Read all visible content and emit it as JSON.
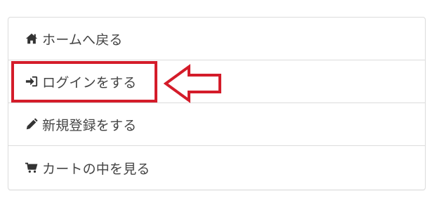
{
  "menu": {
    "items": [
      {
        "label": "ホームへ戻る",
        "icon": "home-icon"
      },
      {
        "label": "ログインをする",
        "icon": "sign-in-icon"
      },
      {
        "label": "新規登録をする",
        "icon": "pencil-icon"
      },
      {
        "label": "カートの中を見る",
        "icon": "cart-icon"
      }
    ]
  },
  "annotation": {
    "highlight_color": "#d41c2a",
    "arrow_direction": "left",
    "highlighted_item": "ログインをする"
  },
  "colors": {
    "text": "#444444",
    "border": "#dcdcdc",
    "icon": "#333333"
  }
}
